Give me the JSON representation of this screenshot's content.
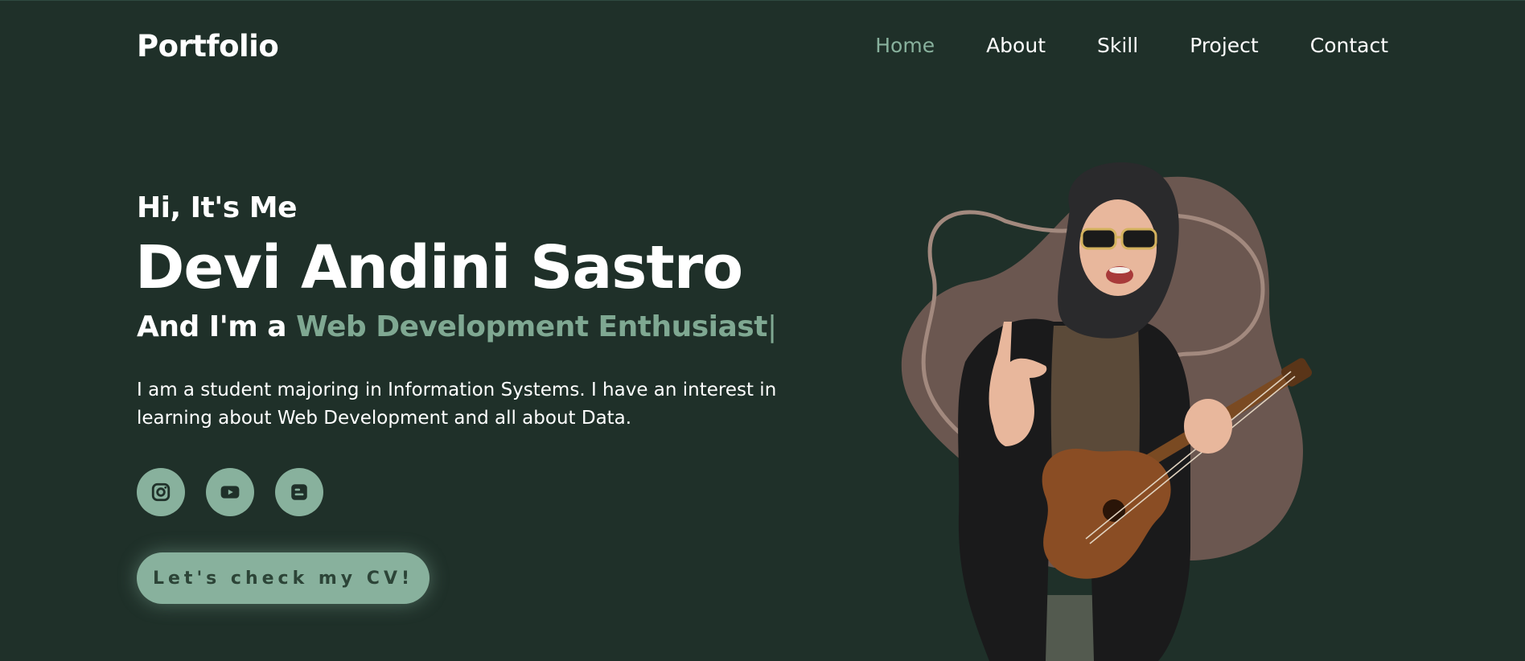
{
  "header": {
    "logo": "Portfolio",
    "nav": [
      {
        "label": "Home",
        "active": true
      },
      {
        "label": "About",
        "active": false
      },
      {
        "label": "Skill",
        "active": false
      },
      {
        "label": "Project",
        "active": false
      },
      {
        "label": "Contact",
        "active": false
      }
    ]
  },
  "hero": {
    "greeting": "Hi, It's Me",
    "name": "Devi Andini Sastro",
    "role_prefix": "And I'm a",
    "role_highlight": "Web Development Enthusiast",
    "role_caret": "|",
    "description": "I am a student majoring in Information Systems. I have an interest in learning about Web Development and all about Data.",
    "socials": [
      {
        "icon": "instagram-icon"
      },
      {
        "icon": "youtube-icon"
      },
      {
        "icon": "blogger-icon"
      }
    ],
    "cv_button": "Let's check my CV!"
  },
  "colors": {
    "background": "#1f3029",
    "accent": "#88b19d",
    "accent_text": "#7fa892",
    "blob": "#6b5750",
    "button_text": "#2c4437"
  }
}
